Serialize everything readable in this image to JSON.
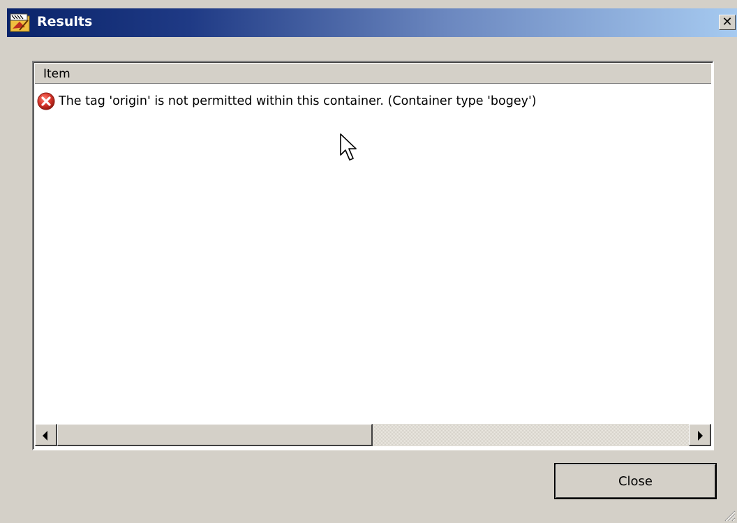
{
  "window": {
    "title": "Results",
    "close_glyph": "✕"
  },
  "list": {
    "column_header": "Item",
    "items": [
      {
        "icon": "error-icon",
        "text": "The tag 'origin' is not permitted within this container. (Container type 'bogey')"
      }
    ]
  },
  "buttons": {
    "close_label": "Close"
  },
  "colors": {
    "title_gradient_start": "#0a246a",
    "title_gradient_end": "#a6caf0",
    "dialog_bg": "#d4d0c8",
    "error_red": "#d6342a"
  }
}
